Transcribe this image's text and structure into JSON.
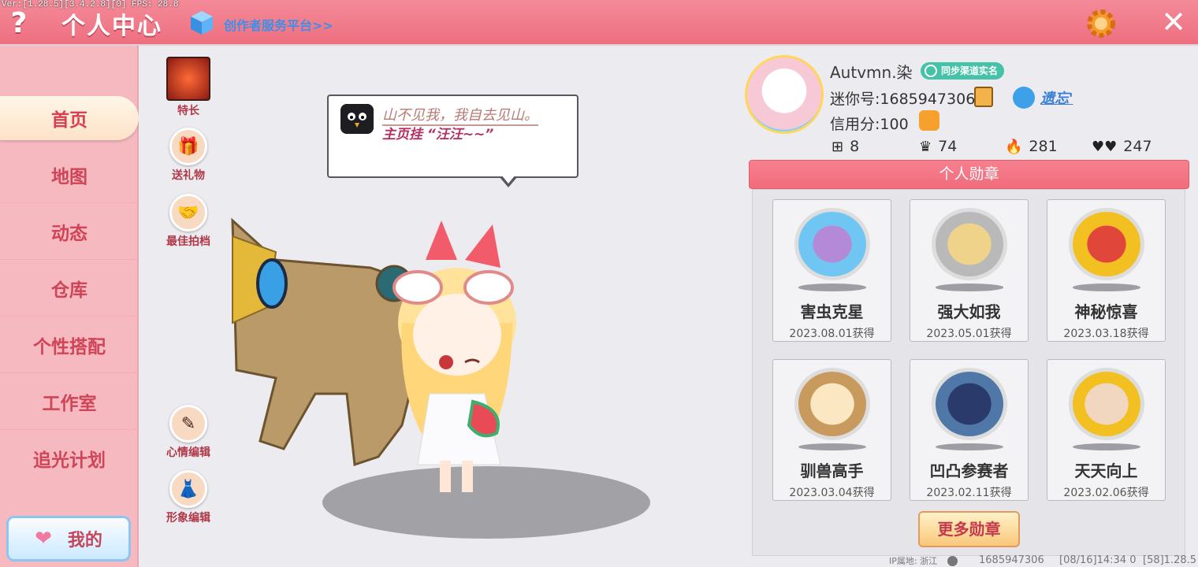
{
  "version_text": "Ver:[1.28.5][3.4.2.8][0] FPS: 28.8",
  "header": {
    "help_label": "?",
    "title": "个人中心",
    "creator_link": "创作者服务平台>>",
    "close_label": "✕"
  },
  "sidebar": {
    "items": [
      {
        "label": "首页",
        "active": true
      },
      {
        "label": "地图"
      },
      {
        "label": "动态"
      },
      {
        "label": "仓库"
      },
      {
        "label": "个性搭配"
      },
      {
        "label": "工作室"
      },
      {
        "label": "追光计划"
      }
    ],
    "mine_label": "我的"
  },
  "left_actions": [
    {
      "label": "特长",
      "icon": "skill-icon"
    },
    {
      "label": "送礼物",
      "icon": "gift-icon"
    },
    {
      "label": "最佳拍档",
      "icon": "handshake-icon"
    },
    {
      "label": "心情编辑",
      "icon": "edit-icon"
    },
    {
      "label": "形象编辑",
      "icon": "outfit-icon"
    }
  ],
  "speech": {
    "line1": "山不见我，我自去见山。",
    "line2": "主页挂 “汪汪~~”"
  },
  "profile": {
    "username": "Autvmn.染",
    "realname_badge": "同步渠道实名",
    "mini_id": "迷你号:1685947306",
    "clan_name": "遗忘'",
    "credit": "信用分:100",
    "stats": [
      {
        "icon": "plus-icon",
        "value": "8"
      },
      {
        "icon": "followers-icon",
        "value": "74"
      },
      {
        "icon": "fire-icon",
        "value": "281"
      },
      {
        "icon": "hearts-icon",
        "value": "247"
      }
    ]
  },
  "medals": {
    "title": "个人勋章",
    "items": [
      {
        "name": "害虫克星",
        "date": "2023.08.01获得",
        "color": "#6fc6f2"
      },
      {
        "name": "强大如我",
        "date": "2023.05.01获得",
        "color": "#b9b9b9"
      },
      {
        "name": "神秘惊喜",
        "date": "2023.03.18获得",
        "color": "#f2c021"
      },
      {
        "name": "驯兽高手",
        "date": "2023.03.04获得",
        "color": "#c99a5e"
      },
      {
        "name": "凹凸参赛者",
        "date": "2023.02.11获得",
        "color": "#4f78a8"
      },
      {
        "name": "天天向上",
        "date": "2023.02.06获得",
        "color": "#f2c021"
      }
    ],
    "more_label": "更多勋章"
  },
  "footer": {
    "ip": "IP属地: 浙江",
    "uid": "1685947306",
    "time": "[08/16]14:34 0",
    "build": "[58]1.28.5"
  },
  "colors": {
    "accent": "#f07585",
    "sidebar": "#f6b9c0",
    "text_red": "#cf4456"
  }
}
